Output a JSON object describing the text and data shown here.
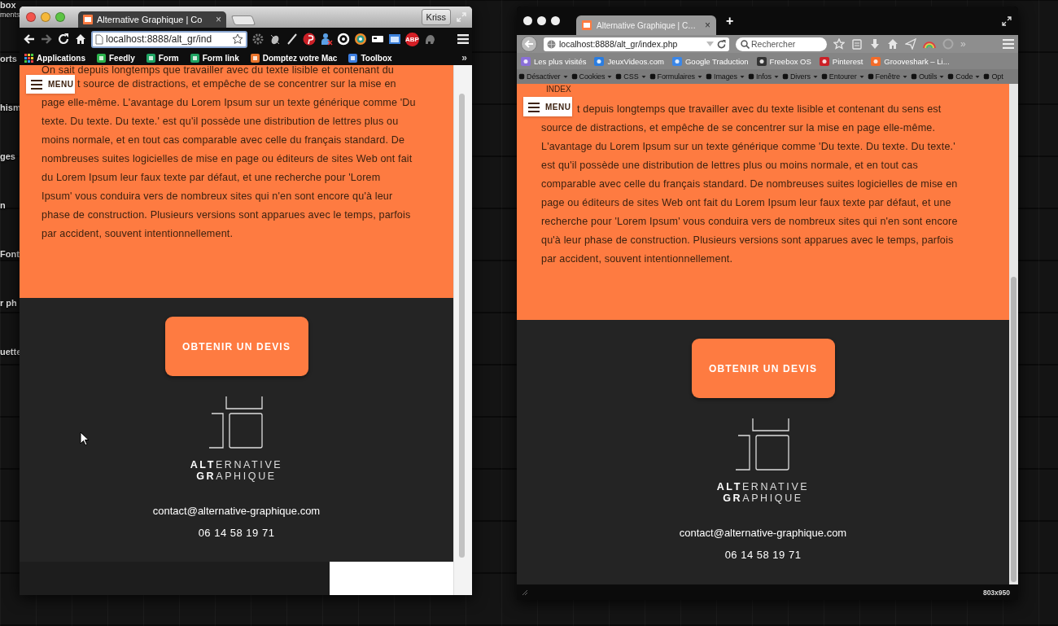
{
  "desktop_labels": [
    "box",
    "ments",
    "orts",
    "hism",
    "ges",
    "n",
    "Font",
    "r ph",
    "uette"
  ],
  "left_window": {
    "tab": {
      "title": "Alternative Graphique | Co",
      "close": "×"
    },
    "profile": "Kriss",
    "address": "localhost:8888/alt_gr/ind",
    "toolbar_badge": "ABP",
    "bookmarks": [
      "Applications",
      "Feedly",
      "Form",
      "Form link",
      "Domptez votre Mac",
      "Toolbox"
    ],
    "bookmarks_overflow": "»",
    "page": {
      "menu": "MENU",
      "paragraph_lines": [
        "On sait depuis longtemps que travailler avec du texte lisible et contenant du",
        "t source de distractions, et empêche de se concentrer sur la mise en",
        "page elle-même. L'avantage du Lorem Ipsum sur un texte générique comme 'Du",
        "texte. Du texte. Du texte.' est qu'il possède une distribution de lettres plus ou",
        "moins normale, et en tout cas comparable avec celle du français standard. De",
        "nombreuses suites logicielles de mise en page ou éditeurs de sites Web ont fait",
        "du Lorem Ipsum leur faux texte par défaut, et une recherche pour 'Lorem",
        "Ipsum' vous conduira vers de nombreux sites qui n'en sont encore qu'à leur",
        "phase de construction. Plusieurs versions sont apparues avec le temps, parfois",
        "par accident, souvent intentionnellement."
      ],
      "cta": "OBTENIR UN DEVIS",
      "logo_lines": [
        "**ALT**ERNATIVE",
        "**GR**APHIQUE"
      ],
      "email": "contact@alternative-graphique.com",
      "phone": "06 14 58 19 71"
    }
  },
  "right_window": {
    "tab": {
      "title": "Alternative Graphique | C…",
      "close": "×"
    },
    "new_tab": "+",
    "address": "localhost:8888/alt_gr/index.php",
    "search": {
      "placeholder": "Rechercher"
    },
    "toolbar_overflow": "»",
    "bookmarks": [
      "Les plus visités",
      "JeuxVideos.com",
      "Google Traduction",
      "Freebox OS",
      "Pinterest",
      "Grooveshark – Li..."
    ],
    "dev_toolbar": [
      "Désactiver",
      "Cookies",
      "CSS",
      "Formulaires",
      "Images",
      "Infos",
      "Divers",
      "Entourer",
      "Fenêtre",
      "Outils",
      "Code",
      "Opt"
    ],
    "page": {
      "heading": "INDEX",
      "menu": "MENU",
      "paragraph_lines": [
        "t depuis longtemps que travailler avec du texte lisible et contenant du sens est",
        "source de distractions, et empêche de se concentrer sur la mise en page elle-même.",
        "L'avantage du Lorem Ipsum sur un texte générique comme 'Du texte. Du texte. Du texte.'",
        "est qu'il possède une distribution de lettres plus ou moins normale, et en tout cas",
        "comparable avec celle du français standard. De nombreuses suites logicielles de mise en",
        "page ou éditeurs de sites Web ont fait du Lorem Ipsum leur faux texte par défaut, et une",
        "recherche pour 'Lorem Ipsum' vous conduira vers de nombreux sites qui n'en sont encore",
        "qu'à leur phase de construction. Plusieurs versions sont apparues avec le temps, parfois",
        "par accident, souvent intentionnellement."
      ],
      "cta": "OBTENIR UN DEVIS",
      "logo_lines": [
        "**ALT**ERNATIVE",
        "**GR**APHIQUE"
      ],
      "email": "contact@alternative-graphique.com",
      "phone": "06 14 58 19 71"
    },
    "status_bar": {
      "viewport_size": "803x950"
    }
  }
}
